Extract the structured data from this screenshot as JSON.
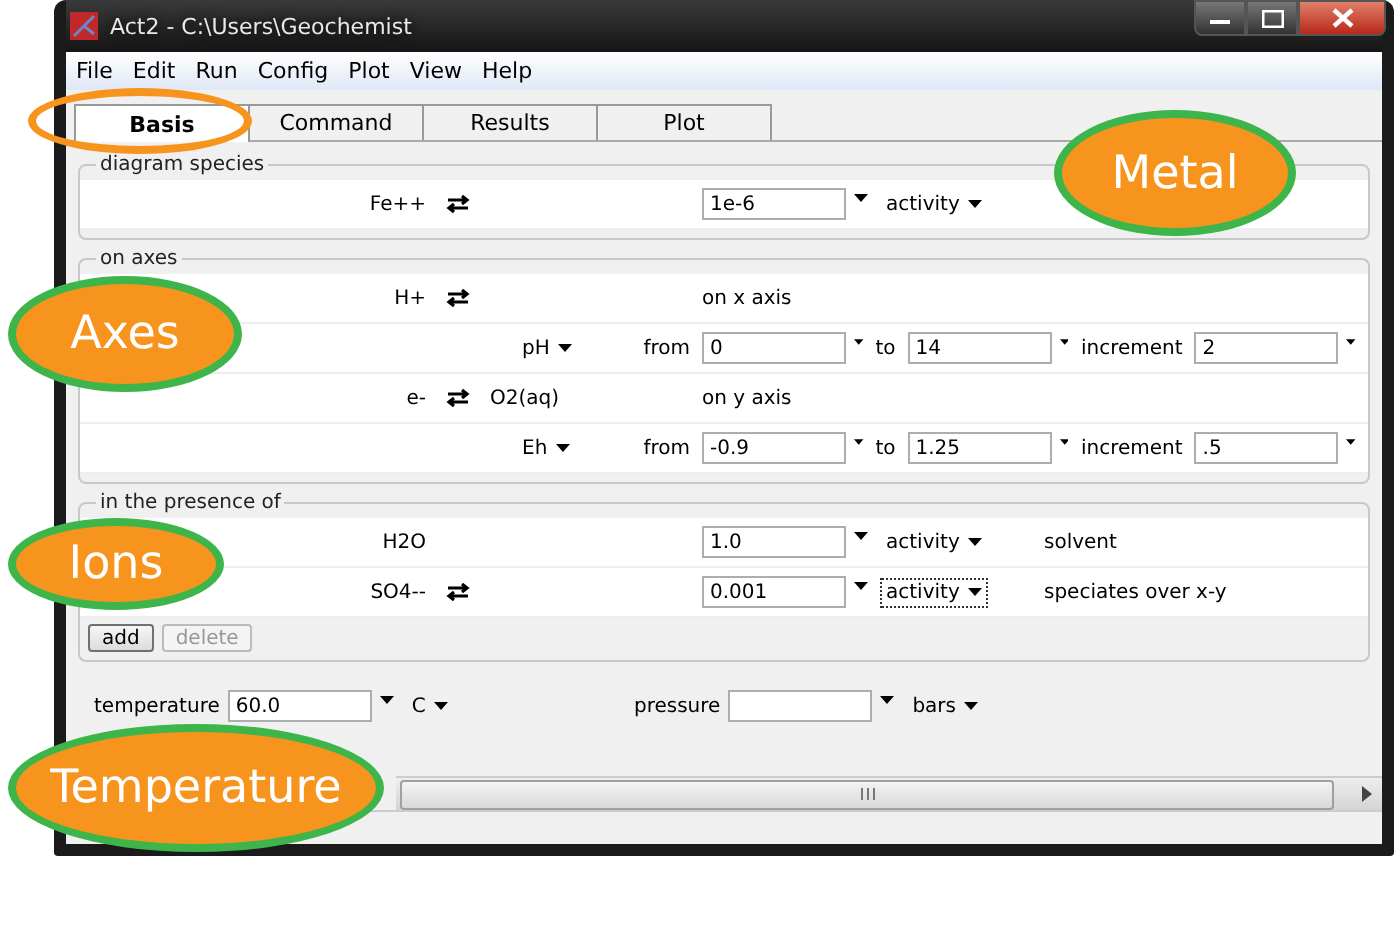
{
  "window": {
    "title": "Act2 - C:\\Users\\Geochemist"
  },
  "menu": [
    "File",
    "Edit",
    "Run",
    "Config",
    "Plot",
    "View",
    "Help"
  ],
  "tabs": [
    {
      "label": "Basis",
      "selected": true
    },
    {
      "label": "Command",
      "selected": false
    },
    {
      "label": "Results",
      "selected": false
    },
    {
      "label": "Plot",
      "selected": false
    }
  ],
  "diagram_species": {
    "title": "diagram species",
    "rows": [
      {
        "species": "Fe++",
        "swappable": true,
        "value": "1e-6",
        "unit": "activity",
        "focused": false
      }
    ]
  },
  "on_axes": {
    "title": "on axes",
    "axes": [
      {
        "species": "H+",
        "swappable": true,
        "axis_label": "on x axis",
        "variable": "pH",
        "from_label": "from",
        "from": "0",
        "to_label": "to",
        "to": "14",
        "increment_label": "increment",
        "increment": "2"
      },
      {
        "species": "e-",
        "swappable": true,
        "partner": "O2(aq)",
        "axis_label": "on y axis",
        "variable": "Eh",
        "from_label": "from",
        "from": "-0.9",
        "to_label": "to",
        "to": "1.25",
        "increment_label": "increment",
        "increment": ".5"
      }
    ]
  },
  "presence": {
    "title": "in the presence of",
    "rows": [
      {
        "species": "H2O",
        "swappable": false,
        "value": "1.0",
        "unit": "activity",
        "focused": false,
        "note": "solvent"
      },
      {
        "species": "SO4--",
        "swappable": true,
        "value": "0.001",
        "unit": "activity",
        "focused": true,
        "note": "speciates over x-y"
      }
    ],
    "buttons": [
      {
        "label": "add",
        "disabled": false
      },
      {
        "label": "delete",
        "disabled": true
      }
    ]
  },
  "conditions": [
    {
      "label": "temperature",
      "value": "60.0",
      "unit": "C"
    },
    {
      "label": "pressure",
      "unit": "bars"
    }
  ],
  "annotations": [
    {
      "kind": "ring"
    },
    {
      "kind": "bubble",
      "text": "Metal"
    },
    {
      "kind": "bubble",
      "text": "Axes"
    },
    {
      "kind": "bubble",
      "text": "Ions"
    },
    {
      "kind": "bubble",
      "text": "Temperature"
    }
  ]
}
